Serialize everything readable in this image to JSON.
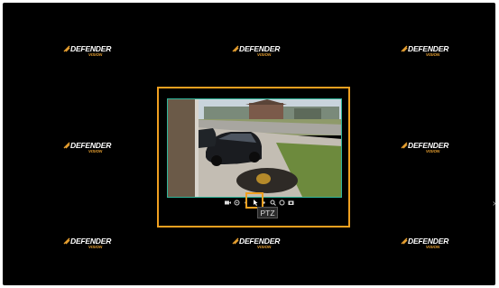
{
  "brand": {
    "name": "DEFENDER",
    "sub": "VISION"
  },
  "tooltip": {
    "label": "PTZ"
  },
  "toolbar": {
    "icons": [
      "video-icon",
      "settings-icon",
      "dot-icon",
      "pointer-icon",
      "dot-icon",
      "zoom-icon",
      "refresh-icon",
      "snapshot-icon"
    ]
  },
  "colors": {
    "highlight": "#f0a020",
    "frame": "#2fb59a",
    "background": "#000000",
    "brand_accent": "#e8a030"
  }
}
